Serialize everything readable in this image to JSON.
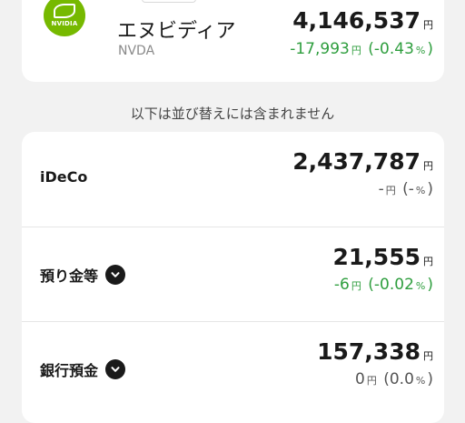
{
  "stock": {
    "logo_text": "NVIDIA",
    "name": "エヌビディア",
    "ticker": "NVDA",
    "amount": "4,146,537",
    "unit": "円",
    "change": "-17,993",
    "change_pct": "-0.43"
  },
  "notice": "以下は並び替えには含まれません",
  "rows": [
    {
      "label": "iDeCo",
      "amount": "2,437,787",
      "unit": "円",
      "change": "-",
      "change_pct": "-"
    },
    {
      "label": "預り金等",
      "amount": "21,555",
      "unit": "円",
      "change": "-6",
      "change_pct": "-0.02"
    },
    {
      "label": "銀行預金",
      "amount": "157,338",
      "unit": "円",
      "change": "0",
      "change_pct": "0.0"
    }
  ],
  "symbols": {
    "yen": "円",
    "open_paren": "(",
    "close_paren": ")",
    "percent": "%"
  },
  "colors": {
    "green": "#2e9e3e",
    "nvidia_green": "#76b900"
  }
}
